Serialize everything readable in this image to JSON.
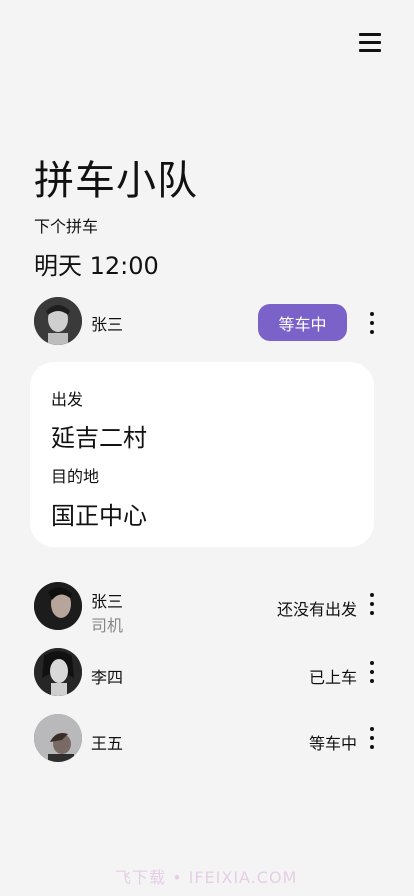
{
  "page_title": "拼车小队",
  "next_ride": {
    "label": "下个拼车",
    "time": "明天 12:00"
  },
  "driver": {
    "name": "张三",
    "status_button": "等车中"
  },
  "route": {
    "depart_label": "出发",
    "depart_value": "延吉二村",
    "dest_label": "目的地",
    "dest_value": "国正中心"
  },
  "members": [
    {
      "name": "张三",
      "role": "司机",
      "status": "还没有出发"
    },
    {
      "name": "李四",
      "status": "已上车"
    },
    {
      "name": "王五",
      "status": "等车中"
    }
  ],
  "watermark": "飞下载 • IFEIXIA.COM",
  "icons": {
    "menu": "hamburger-menu-icon",
    "more": "more-vertical-icon"
  },
  "colors": {
    "accent": "#7a62c9",
    "background": "#f4f4f5",
    "card": "#ffffff",
    "secondary_text": "#888888"
  }
}
